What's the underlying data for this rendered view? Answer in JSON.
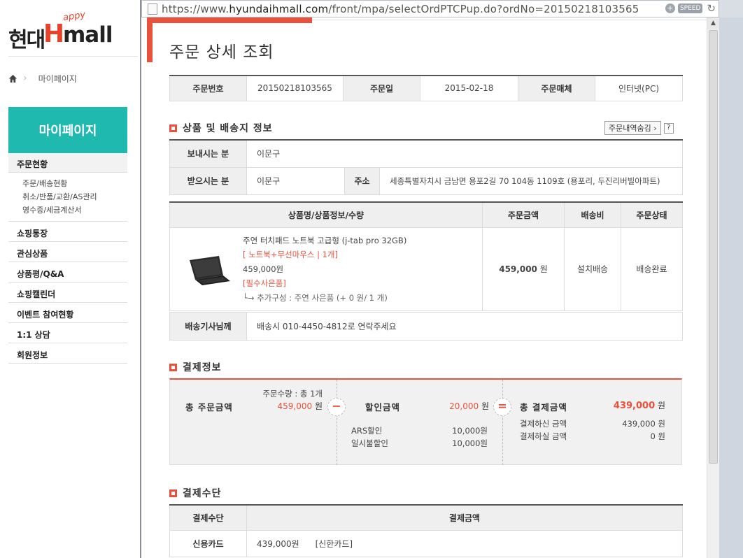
{
  "logo": {
    "brand_ko": "현대",
    "brand_h": "H",
    "brand_mall": "mall",
    "brand_happy": "appy"
  },
  "breadcrumb": {
    "current": "마이페이지"
  },
  "sidebar": {
    "header": "마이페이지",
    "active_section": "주문현황",
    "sub_items": [
      "주문/배송현황",
      "취소/반품/교환/AS관리",
      "영수증/세금계산서"
    ],
    "sections": [
      "쇼핑통장",
      "관심상품",
      "상품평/Q&A",
      "쇼핑캘린더",
      "이벤트 참여현황",
      "1:1 상담",
      "회원정보"
    ]
  },
  "browser": {
    "url_prefix": "https://www.",
    "url_domain": "hyundaihmall.com",
    "url_path": "/front/mpa/selectOrdPTCPup.do?ordNo=20150218103565",
    "speed_label": "SPEED"
  },
  "page": {
    "title": "주문 상세 조회"
  },
  "order_info": {
    "order_no_label": "주문번호",
    "order_no": "20150218103565",
    "order_date_label": "주문일",
    "order_date": "2015-02-18",
    "channel_label": "주문매체",
    "channel": "인터넷(PC)"
  },
  "product_section": {
    "heading": "상품 및 배송지 정보",
    "hide_button": "주문내역숨김",
    "help": "?",
    "sender_label": "보내시는 분",
    "sender": "이문구",
    "receiver_label": "받으시는 분",
    "receiver": "이문구",
    "address_label": "주소",
    "address": "세종특별자치시 금남면 용포2길 70 104동 1109호 (용포리, 두진리버빌아파트)"
  },
  "product_table": {
    "headers": [
      "상품명/상품정보/수량",
      "주문금액",
      "배송비",
      "주문상태"
    ],
    "item": {
      "name": "주연 터치패드 노트북 고급형 (j-tab pro 32GB)",
      "option": "[ 노트북+무선마우스  |  1개]",
      "price": "459,000원",
      "gift_tag": "[필수사은품]",
      "extra": "└→ 추가구성 : 주연 사은품 (+ 0 원/ 1 개)",
      "order_amount": "459,000",
      "order_amount_unit": "원",
      "shipping": "설치배송",
      "status": "배송완료"
    }
  },
  "delivery_message": {
    "label": "배송기사님께",
    "text": "배송시 010-4450-4812로 연락주세요"
  },
  "payment": {
    "heading": "결제정보",
    "total_order_label": "총 주문금액",
    "order_qty_note": "주문수량 : 총 1개",
    "total_order_amount": "459,000",
    "unit": "원",
    "minus_sign": "−",
    "equals_sign": "=",
    "discount_label": "할인금액",
    "discount_amount": "20,000",
    "discount_items": [
      {
        "name": "ARS할인",
        "amount": "10,000원"
      },
      {
        "name": "일시불할인",
        "amount": "10,000원"
      }
    ],
    "total_pay_label": "총 결제금액",
    "total_pay_amount": "439,000",
    "paid_label": "결제하신 금액",
    "paid_amount": "439,000 원",
    "due_label": "결제하실 금액",
    "due_amount": "0 원"
  },
  "method": {
    "heading": "결제수단",
    "col_method": "결제수단",
    "col_amount": "결제금액",
    "method": "신용카드",
    "amount": "439,000원",
    "card": "[신한카드]"
  },
  "colors": {
    "accent": "#e8513b",
    "teal": "#1fb9b0"
  }
}
